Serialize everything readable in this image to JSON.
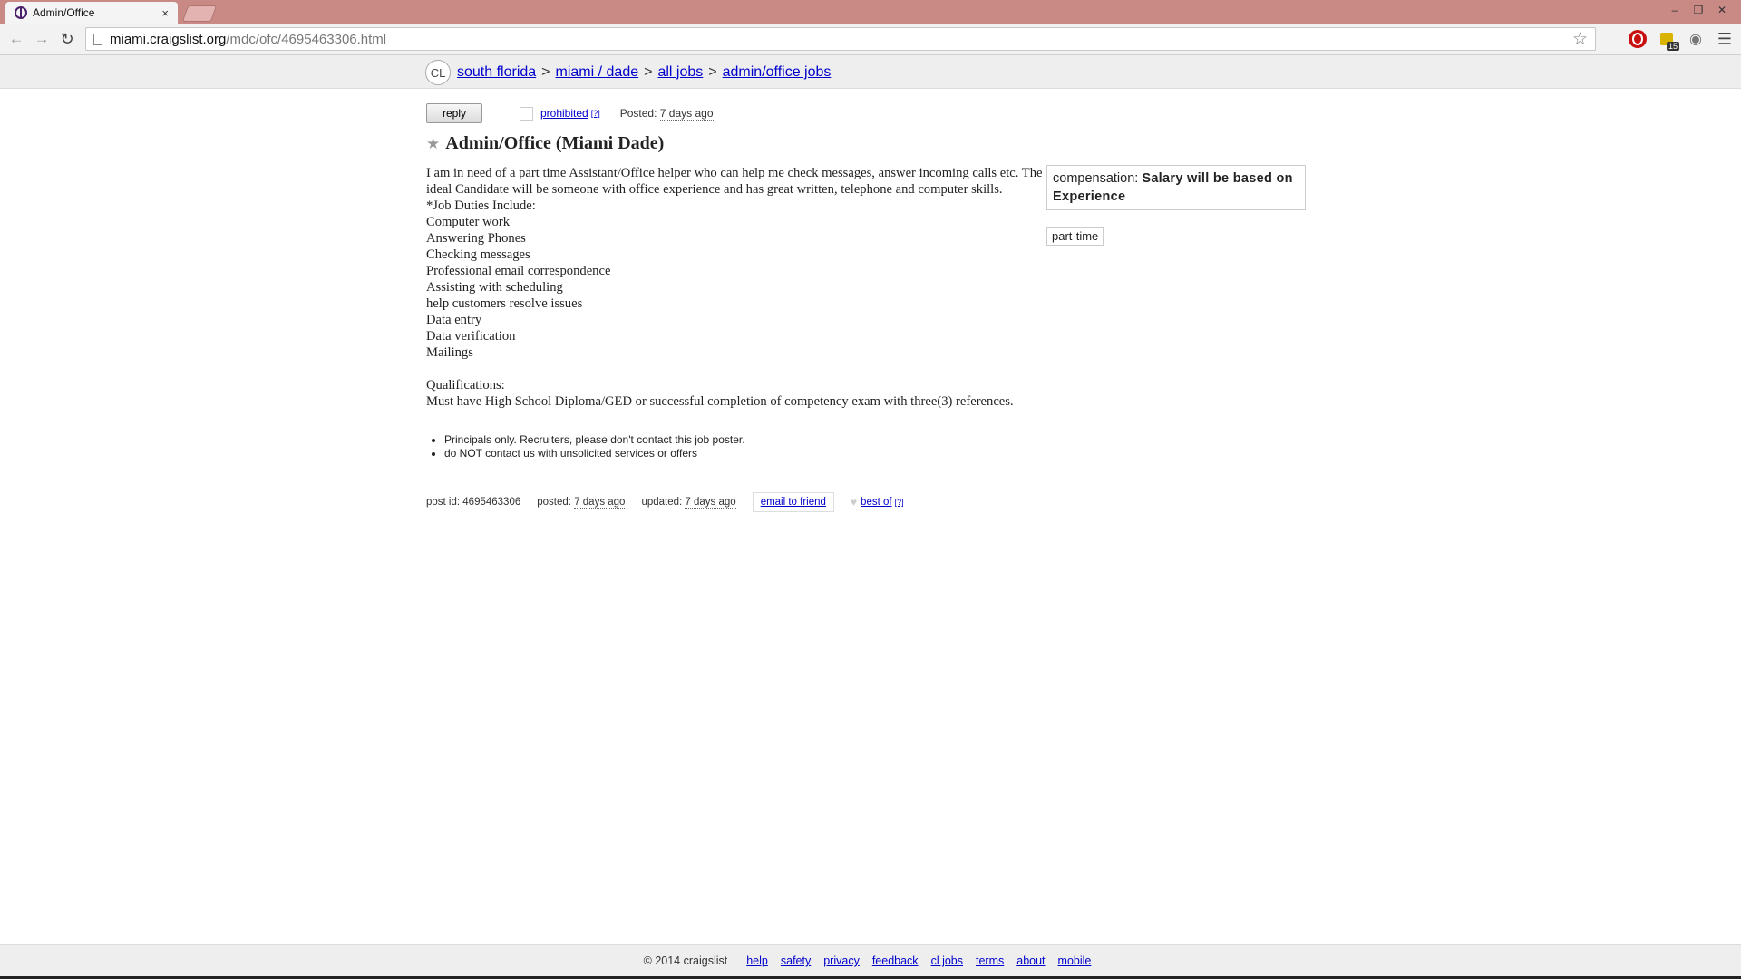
{
  "browser": {
    "tab_title": "Admin/Office",
    "tab_close": "×",
    "url_host": "miami.craigslist.org",
    "url_path": "/mdc/ofc/4695463306.html",
    "ext_badge": "15",
    "win_minimize": "–",
    "win_restore": "❐",
    "win_close": "✕"
  },
  "header": {
    "logo": "CL",
    "breadcrumb": [
      "south florida",
      "miami / dade",
      "all jobs",
      "admin/office jobs"
    ],
    "separator": ">"
  },
  "actions": {
    "reply_label": "reply",
    "prohibited_label": "prohibited",
    "help_mark": "[?]",
    "posted_label": "Posted:",
    "posted_date": "7 days ago"
  },
  "posting": {
    "title": "Admin/Office (Miami Dade)",
    "intro": "I am in need of a part time Assistant/Office helper who can help me check messages, answer incoming calls etc. The ideal Candidate will be someone with office experience and has great written, telephone and computer skills.",
    "duties_header": "*Job Duties Include:",
    "duties": [
      "Computer work",
      "Answering Phones",
      "Checking messages",
      "Professional email correspondence",
      "Assisting with scheduling",
      "help customers resolve issues",
      "Data entry",
      "Data verification",
      "Mailings"
    ],
    "qualifications_header": "Qualifications:",
    "qualifications": "Must have High School Diploma/GED or successful completion of competency exam with three(3) references."
  },
  "attributes": {
    "compensation_label": "compensation:",
    "compensation_value": "Salary will be based on Experience",
    "employment_type": "part-time"
  },
  "notices": [
    "Principals only. Recruiters, please don't contact this job poster.",
    "do NOT contact us with unsolicited services or offers"
  ],
  "postinfo": {
    "post_id_label": "post id:",
    "post_id": "4695463306",
    "posted_label": "posted:",
    "posted_date": "7 days ago",
    "updated_label": "updated:",
    "updated_date": "7 days ago",
    "email_friend": "email to friend",
    "best_of": "best of",
    "help_mark": "[?]"
  },
  "footer": {
    "copyright": "© 2014 craigslist",
    "links": [
      "help",
      "safety",
      "privacy",
      "feedback",
      "cl jobs",
      "terms",
      "about",
      "mobile"
    ]
  }
}
